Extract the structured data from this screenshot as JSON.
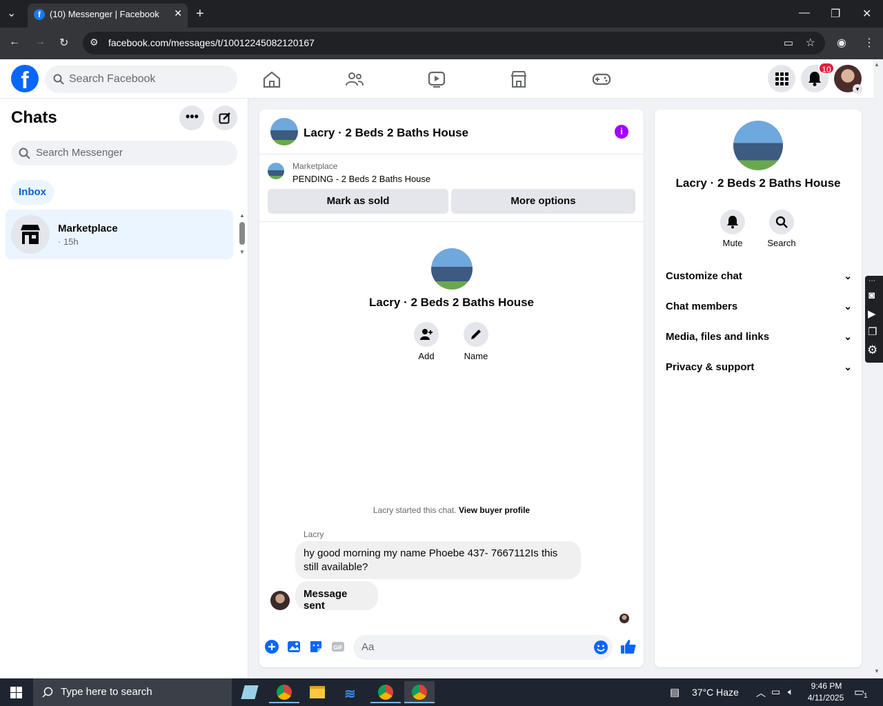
{
  "browser": {
    "tab_title": "(10) Messenger | Facebook",
    "tab_favicon": "f",
    "url": "facebook.com/messages/t/10012245082120167"
  },
  "header": {
    "logo": "f",
    "search_placeholder": "Search Facebook",
    "notification_count": "10",
    "nav_icons": [
      "home-icon",
      "friends-icon",
      "watch-icon",
      "marketplace-icon",
      "gaming-icon"
    ]
  },
  "sidebar": {
    "title": "Chats",
    "search_placeholder": "Search Messenger",
    "filter_label": "Inbox",
    "chats": [
      {
        "name": "Marketplace",
        "time": "· 15h"
      }
    ]
  },
  "chat": {
    "title": "Lacry · 2 Beds 2 Baths House",
    "marketplace_label": "Marketplace",
    "listing_status": "PENDING - 2 Beds 2 Baths House",
    "mark_sold_label": "Mark as sold",
    "more_options_label": "More options",
    "center_name": "Lacry · 2 Beds 2 Baths House",
    "add_label": "Add",
    "name_label": "Name",
    "started_text": "Lacry started this chat.",
    "view_profile_link": "View buyer profile",
    "sender_name": "Lacry",
    "messages": [
      {
        "text": "hy good morning my name Phoebe 437- 7667112Is this still available?"
      },
      {
        "text": "Message sent"
      }
    ],
    "composer_placeholder": "Aa"
  },
  "right_panel": {
    "name": "Lacry · 2 Beds 2 Baths House",
    "mute_label": "Mute",
    "search_label": "Search",
    "sections": [
      "Customize chat",
      "Chat members",
      "Media, files and links",
      "Privacy & support"
    ]
  },
  "taskbar": {
    "search_placeholder": "Type here to search",
    "weather": "37°C  Haze",
    "time": "9:46 PM",
    "date": "4/11/2025",
    "notification_count": "1"
  },
  "colors": {
    "fb_blue": "#0866ff",
    "messenger_purple": "#a200ff",
    "badge_red": "#e41e3f"
  }
}
